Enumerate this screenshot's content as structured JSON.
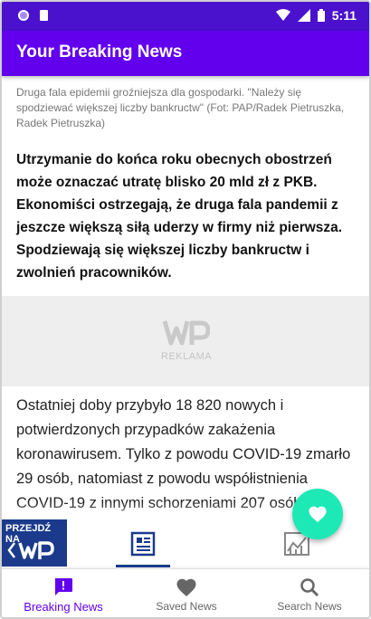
{
  "status_bar": {
    "time": "5:11"
  },
  "app_bar": {
    "title": "Your Breaking News"
  },
  "article": {
    "caption": "Druga fala epidemii groźniejsza dla gospodarki. \"Należy się spodziewać większej liczby bankructw\" (Fot: PAP/Radek Pietruszka, Radek Pietruszka)",
    "lead": "Utrzymanie do końca roku obecnych obostrzeń może oznaczać utratę blisko 20 mld zł z PKB. Ekonomiści ostrzegają, że druga fala pandemii z jeszcze większą siłą uderzy w firmy niż pierwsza. Spodziewają się większej liczby bankructw i zwolnień pracowników.",
    "ad_label": "REKLAMA",
    "body": "Ostatniej doby przybyło 18 820 nowych i potwierdzonych przypadków zakażenia koronawirusem. Tylko z powodu COVID-19 zmarło 29 osób, natomiast z powodu współistnienia COVID-19 z innymi schorzeniami 207 osób."
  },
  "article_toolbar": {
    "wp_badge_label": "PRZEJDŹ NA"
  },
  "bottom_nav": {
    "items": [
      {
        "label": "Breaking News",
        "icon": "feedback-icon",
        "active": true
      },
      {
        "label": "Saved News",
        "icon": "heart-icon",
        "active": false
      },
      {
        "label": "Search News",
        "icon": "search-icon",
        "active": false
      }
    ]
  },
  "colors": {
    "status_bar": "#4a12cc",
    "app_bar": "#6200ee",
    "fab": "#1de9b6",
    "wp_blue": "#1b3a8c",
    "active_nav": "#6200ee"
  }
}
